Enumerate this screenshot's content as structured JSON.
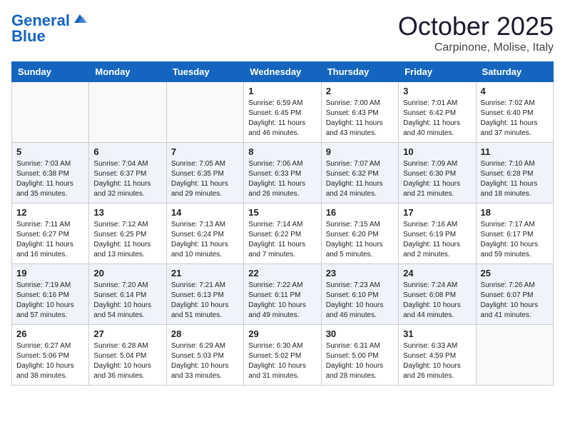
{
  "header": {
    "logo_line1": "General",
    "logo_line2": "Blue",
    "month": "October 2025",
    "location": "Carpinone, Molise, Italy"
  },
  "days_of_week": [
    "Sunday",
    "Monday",
    "Tuesday",
    "Wednesday",
    "Thursday",
    "Friday",
    "Saturday"
  ],
  "weeks": [
    [
      {
        "day": "",
        "sunrise": "",
        "sunset": "",
        "daylight": ""
      },
      {
        "day": "",
        "sunrise": "",
        "sunset": "",
        "daylight": ""
      },
      {
        "day": "",
        "sunrise": "",
        "sunset": "",
        "daylight": ""
      },
      {
        "day": "1",
        "sunrise": "Sunrise: 6:59 AM",
        "sunset": "Sunset: 6:45 PM",
        "daylight": "Daylight: 11 hours and 46 minutes."
      },
      {
        "day": "2",
        "sunrise": "Sunrise: 7:00 AM",
        "sunset": "Sunset: 6:43 PM",
        "daylight": "Daylight: 11 hours and 43 minutes."
      },
      {
        "day": "3",
        "sunrise": "Sunrise: 7:01 AM",
        "sunset": "Sunset: 6:42 PM",
        "daylight": "Daylight: 11 hours and 40 minutes."
      },
      {
        "day": "4",
        "sunrise": "Sunrise: 7:02 AM",
        "sunset": "Sunset: 6:40 PM",
        "daylight": "Daylight: 11 hours and 37 minutes."
      }
    ],
    [
      {
        "day": "5",
        "sunrise": "Sunrise: 7:03 AM",
        "sunset": "Sunset: 6:38 PM",
        "daylight": "Daylight: 11 hours and 35 minutes."
      },
      {
        "day": "6",
        "sunrise": "Sunrise: 7:04 AM",
        "sunset": "Sunset: 6:37 PM",
        "daylight": "Daylight: 11 hours and 32 minutes."
      },
      {
        "day": "7",
        "sunrise": "Sunrise: 7:05 AM",
        "sunset": "Sunset: 6:35 PM",
        "daylight": "Daylight: 11 hours and 29 minutes."
      },
      {
        "day": "8",
        "sunrise": "Sunrise: 7:06 AM",
        "sunset": "Sunset: 6:33 PM",
        "daylight": "Daylight: 11 hours and 26 minutes."
      },
      {
        "day": "9",
        "sunrise": "Sunrise: 7:07 AM",
        "sunset": "Sunset: 6:32 PM",
        "daylight": "Daylight: 11 hours and 24 minutes."
      },
      {
        "day": "10",
        "sunrise": "Sunrise: 7:09 AM",
        "sunset": "Sunset: 6:30 PM",
        "daylight": "Daylight: 11 hours and 21 minutes."
      },
      {
        "day": "11",
        "sunrise": "Sunrise: 7:10 AM",
        "sunset": "Sunset: 6:28 PM",
        "daylight": "Daylight: 11 hours and 18 minutes."
      }
    ],
    [
      {
        "day": "12",
        "sunrise": "Sunrise: 7:11 AM",
        "sunset": "Sunset: 6:27 PM",
        "daylight": "Daylight: 11 hours and 16 minutes."
      },
      {
        "day": "13",
        "sunrise": "Sunrise: 7:12 AM",
        "sunset": "Sunset: 6:25 PM",
        "daylight": "Daylight: 11 hours and 13 minutes."
      },
      {
        "day": "14",
        "sunrise": "Sunrise: 7:13 AM",
        "sunset": "Sunset: 6:24 PM",
        "daylight": "Daylight: 11 hours and 10 minutes."
      },
      {
        "day": "15",
        "sunrise": "Sunrise: 7:14 AM",
        "sunset": "Sunset: 6:22 PM",
        "daylight": "Daylight: 11 hours and 7 minutes."
      },
      {
        "day": "16",
        "sunrise": "Sunrise: 7:15 AM",
        "sunset": "Sunset: 6:20 PM",
        "daylight": "Daylight: 11 hours and 5 minutes."
      },
      {
        "day": "17",
        "sunrise": "Sunrise: 7:16 AM",
        "sunset": "Sunset: 6:19 PM",
        "daylight": "Daylight: 11 hours and 2 minutes."
      },
      {
        "day": "18",
        "sunrise": "Sunrise: 7:17 AM",
        "sunset": "Sunset: 6:17 PM",
        "daylight": "Daylight: 10 hours and 59 minutes."
      }
    ],
    [
      {
        "day": "19",
        "sunrise": "Sunrise: 7:19 AM",
        "sunset": "Sunset: 6:16 PM",
        "daylight": "Daylight: 10 hours and 57 minutes."
      },
      {
        "day": "20",
        "sunrise": "Sunrise: 7:20 AM",
        "sunset": "Sunset: 6:14 PM",
        "daylight": "Daylight: 10 hours and 54 minutes."
      },
      {
        "day": "21",
        "sunrise": "Sunrise: 7:21 AM",
        "sunset": "Sunset: 6:13 PM",
        "daylight": "Daylight: 10 hours and 51 minutes."
      },
      {
        "day": "22",
        "sunrise": "Sunrise: 7:22 AM",
        "sunset": "Sunset: 6:11 PM",
        "daylight": "Daylight: 10 hours and 49 minutes."
      },
      {
        "day": "23",
        "sunrise": "Sunrise: 7:23 AM",
        "sunset": "Sunset: 6:10 PM",
        "daylight": "Daylight: 10 hours and 46 minutes."
      },
      {
        "day": "24",
        "sunrise": "Sunrise: 7:24 AM",
        "sunset": "Sunset: 6:08 PM",
        "daylight": "Daylight: 10 hours and 44 minutes."
      },
      {
        "day": "25",
        "sunrise": "Sunrise: 7:26 AM",
        "sunset": "Sunset: 6:07 PM",
        "daylight": "Daylight: 10 hours and 41 minutes."
      }
    ],
    [
      {
        "day": "26",
        "sunrise": "Sunrise: 6:27 AM",
        "sunset": "Sunset: 5:06 PM",
        "daylight": "Daylight: 10 hours and 38 minutes."
      },
      {
        "day": "27",
        "sunrise": "Sunrise: 6:28 AM",
        "sunset": "Sunset: 5:04 PM",
        "daylight": "Daylight: 10 hours and 36 minutes."
      },
      {
        "day": "28",
        "sunrise": "Sunrise: 6:29 AM",
        "sunset": "Sunset: 5:03 PM",
        "daylight": "Daylight: 10 hours and 33 minutes."
      },
      {
        "day": "29",
        "sunrise": "Sunrise: 6:30 AM",
        "sunset": "Sunset: 5:02 PM",
        "daylight": "Daylight: 10 hours and 31 minutes."
      },
      {
        "day": "30",
        "sunrise": "Sunrise: 6:31 AM",
        "sunset": "Sunset: 5:00 PM",
        "daylight": "Daylight: 10 hours and 28 minutes."
      },
      {
        "day": "31",
        "sunrise": "Sunrise: 6:33 AM",
        "sunset": "Sunset: 4:59 PM",
        "daylight": "Daylight: 10 hours and 26 minutes."
      },
      {
        "day": "",
        "sunrise": "",
        "sunset": "",
        "daylight": ""
      }
    ]
  ]
}
